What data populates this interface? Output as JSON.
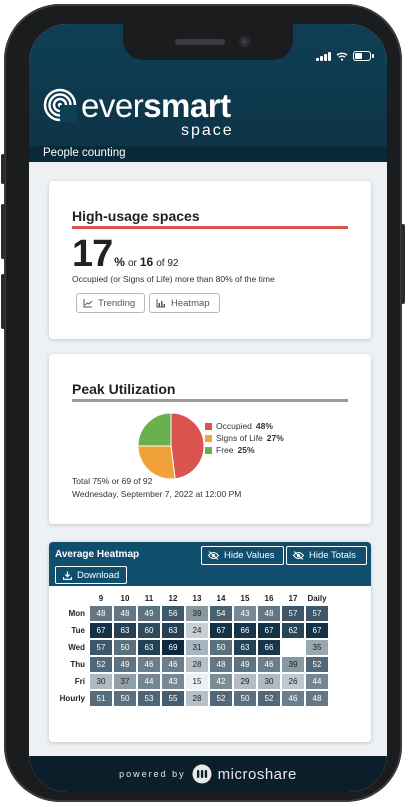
{
  "app": {
    "logo_text_1": "ever",
    "logo_text_2": "smart",
    "logo_sub": "space",
    "subtitle": "People counting"
  },
  "high_usage": {
    "title": "High-usage spaces",
    "percent": "17",
    "percent_sign": "%",
    "or_text": "or",
    "count": "16",
    "of_text": "of 92",
    "description": "Occupied (or Signs of Life) more than 80% of the time",
    "buttons": [
      {
        "label": "Trending",
        "icon": "line-chart-icon"
      },
      {
        "label": "Heatmap",
        "icon": "bar-chart-icon"
      }
    ]
  },
  "peak": {
    "title": "Peak Utilization",
    "legend": [
      {
        "label": "Occupied",
        "value": "48%",
        "color": "#d9534f"
      },
      {
        "label": "Signs of Life",
        "value": "27%",
        "color": "#f0a13a"
      },
      {
        "label": "Free",
        "value": "25%",
        "color": "#6ab04c"
      }
    ],
    "total_line": "Total 75% or 69 of 92",
    "timestamp": "Wednesday, September 7, 2022 at 12:00 PM"
  },
  "chart_data": {
    "type": "pie",
    "title": "Peak Utilization",
    "categories": [
      "Occupied",
      "Signs of Life",
      "Free"
    ],
    "values": [
      48,
      27,
      25
    ],
    "colors": [
      "#d9534f",
      "#f0a13a",
      "#6ab04c"
    ],
    "legend_placement": "right"
  },
  "heatmap": {
    "title": "Average Heatmap",
    "hide_values_label": "Hide Values",
    "hide_totals_label": "Hide Totals",
    "download_label": "Download",
    "columns": [
      "9",
      "10",
      "11",
      "12",
      "13",
      "14",
      "15",
      "16",
      "17",
      "Daily"
    ],
    "rows": [
      {
        "label": "Mon",
        "values": [
          "48",
          "48",
          "49",
          "56",
          "39",
          "54",
          "43",
          "48",
          "57",
          "57"
        ]
      },
      {
        "label": "Tue",
        "values": [
          "67",
          "63",
          "60",
          "63",
          "24",
          "67",
          "66",
          "67",
          "62",
          "67"
        ]
      },
      {
        "label": "Wed",
        "values": [
          "57",
          "50",
          "63",
          "69",
          "31",
          "50",
          "63",
          "66",
          "",
          "35"
        ]
      },
      {
        "label": "Thu",
        "values": [
          "52",
          "49",
          "46",
          "46",
          "28",
          "48",
          "49",
          "46",
          "39",
          "52"
        ]
      },
      {
        "label": "Fri",
        "values": [
          "30",
          "37",
          "44",
          "43",
          "15",
          "42",
          "29",
          "30",
          "26",
          "44"
        ]
      },
      {
        "label": "Hourly",
        "values": [
          "51",
          "50",
          "53",
          "55",
          "28",
          "52",
          "50",
          "52",
          "46",
          "48"
        ]
      }
    ]
  },
  "footer": {
    "powered_by": "powered by",
    "brand": "microshare"
  }
}
